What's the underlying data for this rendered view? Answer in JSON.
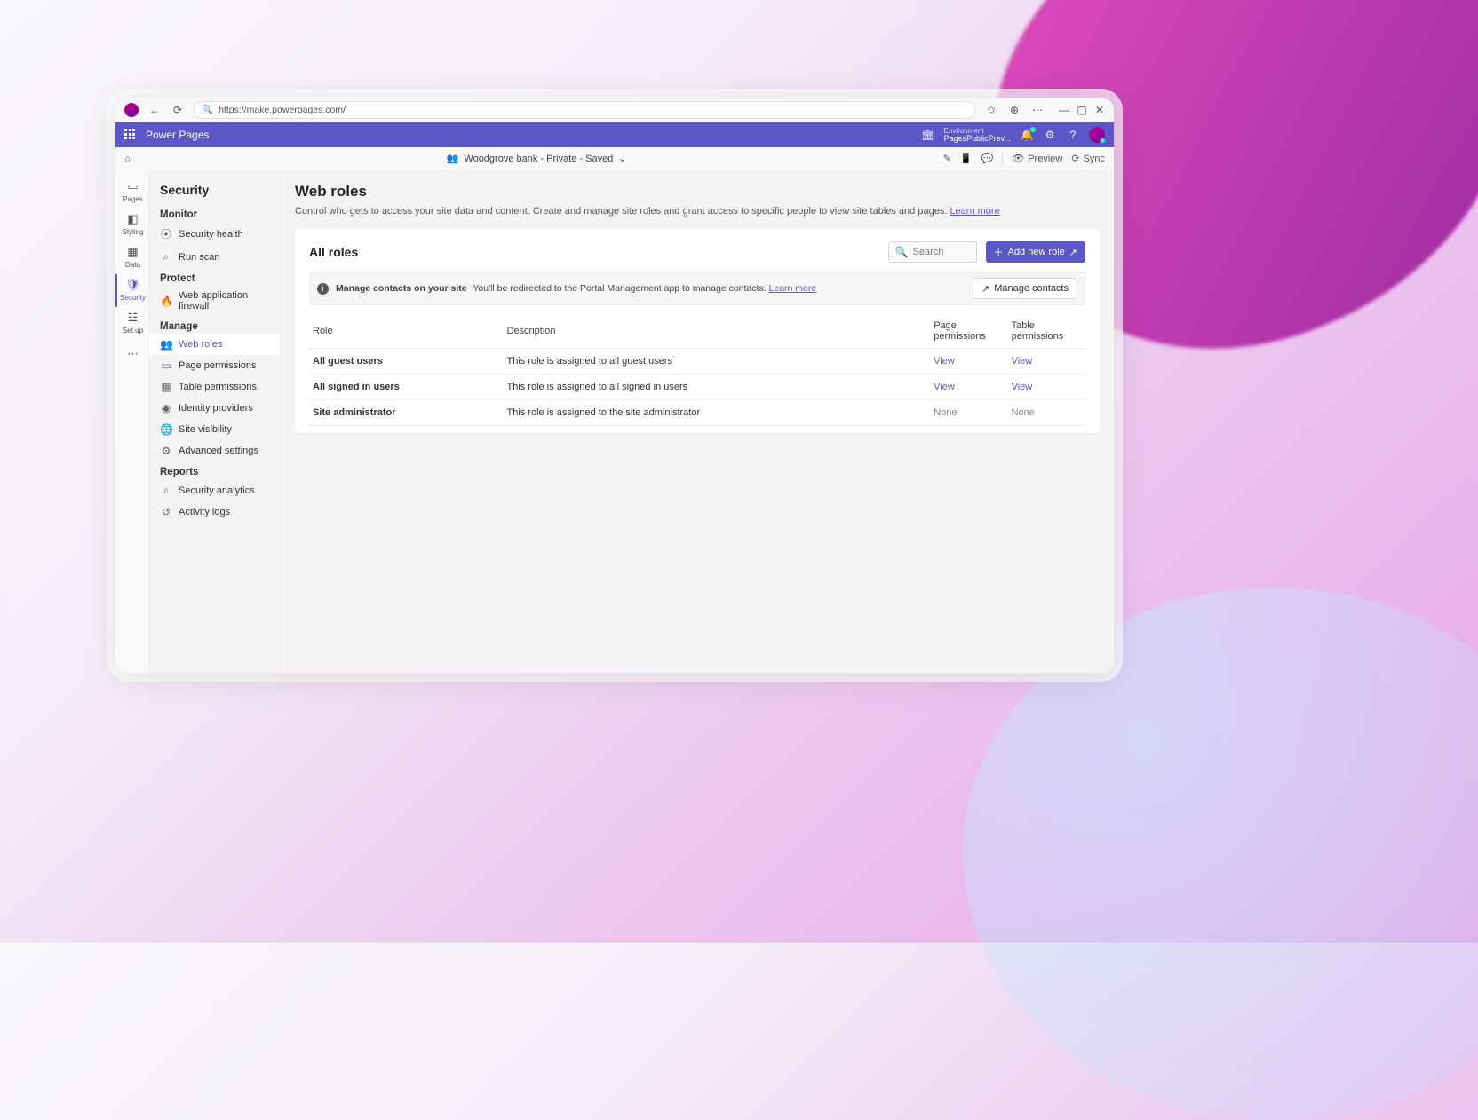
{
  "browser": {
    "url": "https://make.powerpages.com/"
  },
  "appbar": {
    "product": "Power Pages",
    "env_label": "Environment",
    "env_name": "PagesPublicPrev..."
  },
  "crumb": {
    "site": "Woodgrove bank - Private - Saved",
    "preview": "Preview",
    "sync": "Sync"
  },
  "rail": [
    {
      "id": "pages",
      "label": "Pages"
    },
    {
      "id": "styling",
      "label": "Styling"
    },
    {
      "id": "data",
      "label": "Data"
    },
    {
      "id": "security",
      "label": "Security"
    },
    {
      "id": "setup",
      "label": "Set up"
    }
  ],
  "sidepanel": {
    "title": "Security",
    "groups": [
      {
        "label": "Monitor",
        "items": [
          {
            "id": "security-health",
            "label": "Security health"
          },
          {
            "id": "run-scan",
            "label": "Run scan"
          }
        ]
      },
      {
        "label": "Protect",
        "items": [
          {
            "id": "web-application-firewall",
            "label": "Web application firewall"
          }
        ]
      },
      {
        "label": "Manage",
        "items": [
          {
            "id": "web-roles",
            "label": "Web roles",
            "active": true
          },
          {
            "id": "page-permissions",
            "label": "Page permissions"
          },
          {
            "id": "table-permissions",
            "label": "Table permissions"
          },
          {
            "id": "identity-providers",
            "label": "Identity providers"
          },
          {
            "id": "site-visibility",
            "label": "Site visibility"
          },
          {
            "id": "advanced-settings",
            "label": "Advanced settings"
          }
        ]
      },
      {
        "label": "Reports",
        "items": [
          {
            "id": "security-analytics",
            "label": "Security analytics"
          },
          {
            "id": "activity-logs",
            "label": "Activity logs"
          }
        ]
      }
    ]
  },
  "main": {
    "heading": "Web roles",
    "desc": "Control who gets to access your site data and content. Create and manage site roles and grant access to specific people to view site tables and pages.",
    "learn_more": "Learn more",
    "card_title": "All roles",
    "search_placeholder": "Search",
    "add_new_role": "Add new role",
    "banner_title": "Manage contacts on your site",
    "banner_body": "You'll be redirected to the Portal Management app to manage contacts.",
    "banner_learn": "Learn more",
    "manage_contacts": "Manage contacts",
    "columns": {
      "role": "Role",
      "desc": "Description",
      "pp": "Page permissions",
      "tp": "Table permissions"
    },
    "rows": [
      {
        "role": "All guest users",
        "desc": "This role is assigned to all guest users",
        "pp": "View",
        "tp": "View",
        "link": true
      },
      {
        "role": "All signed in users",
        "desc": "This role is assigned to all signed in users",
        "pp": "View",
        "tp": "View",
        "link": true
      },
      {
        "role": "Site administrator",
        "desc": "This role is assigned to the site administrator",
        "pp": "None",
        "tp": "None",
        "link": false
      }
    ]
  }
}
